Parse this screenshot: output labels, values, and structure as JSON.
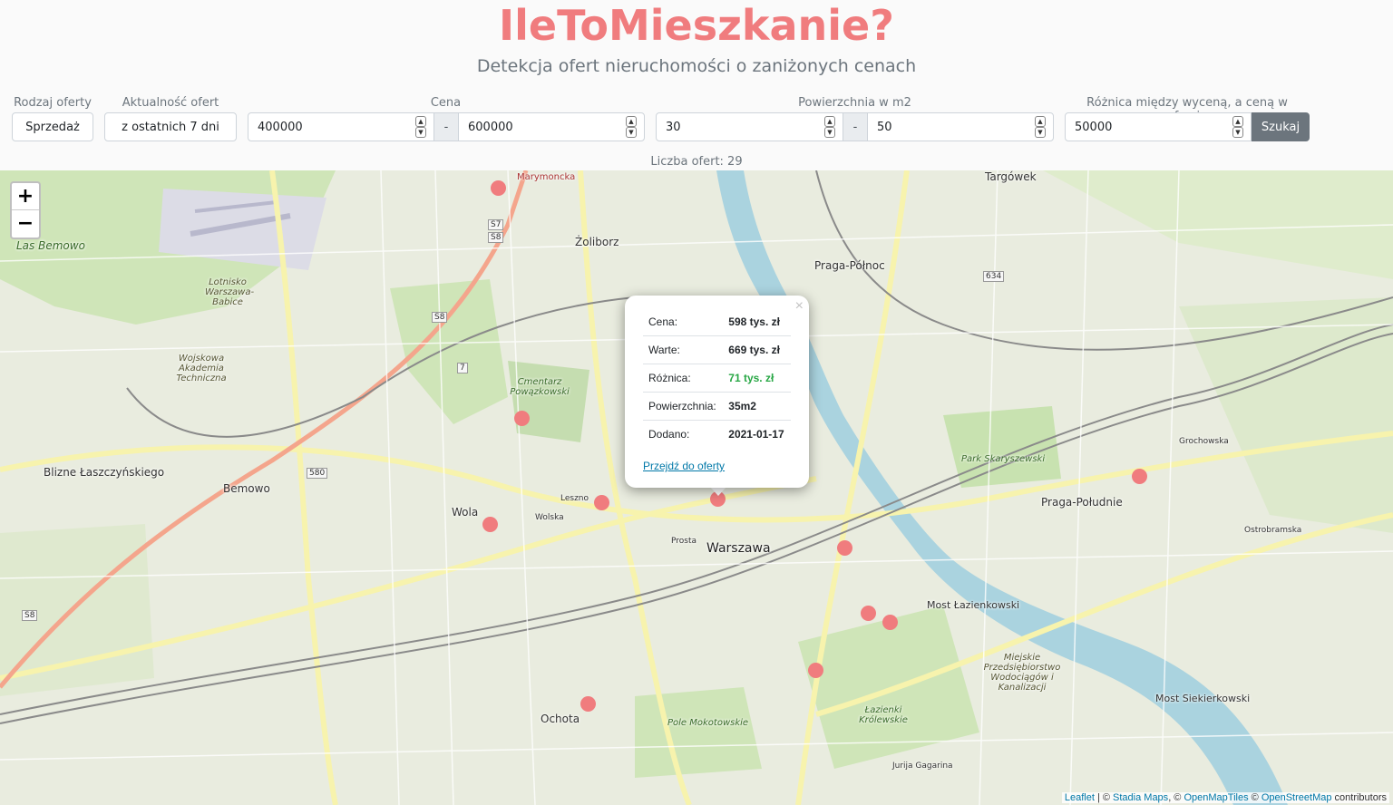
{
  "header": {
    "title": "IleToMieszkanie?",
    "subtitle": "Detekcja ofert nieruchomości o zaniżonych cenach"
  },
  "filters": {
    "offer_type_label": "Rodzaj oferty",
    "offer_type_value": "Sprzedaż",
    "recency_label": "Aktualność ofert",
    "recency_value": "z ostatnich 7 dni",
    "price_label": "Cena",
    "price_min": "400000",
    "price_max": "600000",
    "area_label": "Powierzchnia w m2",
    "area_min": "30",
    "area_max": "50",
    "range_separator": "-",
    "diff_label": "Różnica między wyceną, a ceną w ofercie",
    "diff_value": "50000",
    "search_button": "Szukaj"
  },
  "results": {
    "count_label": "Liczba ofert: 29"
  },
  "map": {
    "zoom_in": "+",
    "zoom_out": "−",
    "labels": {
      "targowek": "Targówek",
      "marymoncka": "Marymoncka",
      "zoliborz": "Żoliborz",
      "praga_polnoc": "Praga-Północ",
      "las_bemowo": "Las Bemowo",
      "lotnisko": "Lotnisko Warszawa-Babice",
      "wojskowa": "Wojskowa Akademia Techniczna",
      "cmentarz": "Cmentarz Powązkowski",
      "bemowo": "Bemowo",
      "blizne": "Blizne Łaszczyńskiego",
      "wola": "Wola",
      "warszawa": "Warszawa",
      "park_skaryszewski": "Park Skaryszewski",
      "praga_poludnie": "Praga-Południe",
      "most_lazienkowski": "Most Łazienkowski",
      "ochota": "Ochota",
      "pole_mokotowskie": "Pole Mokotowskie",
      "lazienki": "Łazienki Królewskie",
      "miejskie": "Miejskie Przedsiębiorstwo Wodociągów i Kanalizacji",
      "most_siekierkowski": "Most Siekierkowski",
      "grochowska": "Grochowska",
      "ostrobramska": "Ostrobramska",
      "wolska": "Wolska",
      "prosta": "Prosta",
      "leszno": "Leszno",
      "jurija": "Jurija Gagarina"
    },
    "road_badges": [
      "S7",
      "S8",
      "S8",
      "7",
      "580",
      "634",
      "S8"
    ],
    "marker_color": "#f07c7e"
  },
  "popup": {
    "close": "×",
    "rows": [
      {
        "label": "Cena:",
        "value": "598 tys. zł"
      },
      {
        "label": "Warte:",
        "value": "669 tys. zł"
      },
      {
        "label": "Różnica:",
        "value": "71 tys. zł"
      },
      {
        "label": "Powierzchnia:",
        "value": "35m2"
      },
      {
        "label": "Dodano:",
        "value": "2021-01-17"
      }
    ],
    "link": "Przejdź do oferty"
  },
  "attribution": {
    "leaflet": "Leaflet",
    "sep1": " | © ",
    "stadia": "Stadia Maps",
    "sep2": ", © ",
    "omt": "OpenMapTiles",
    "sep3": " © ",
    "osm": "OpenStreetMap",
    "tail": " contributors"
  }
}
